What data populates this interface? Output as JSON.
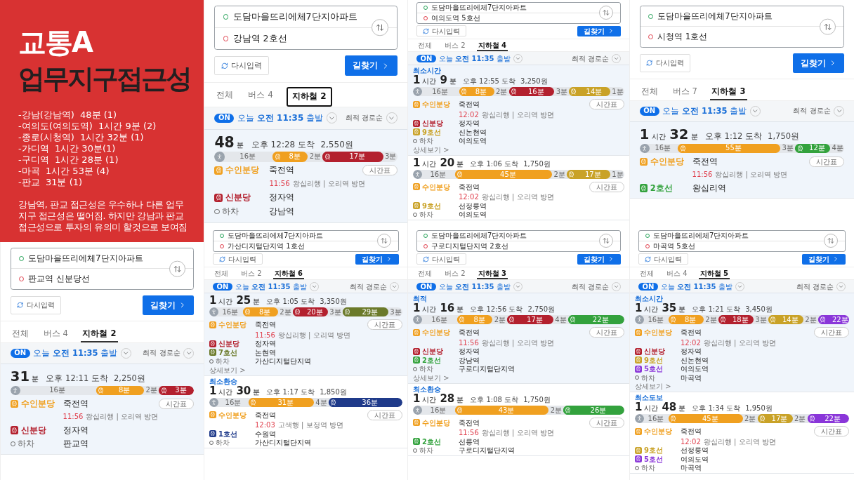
{
  "slide": {
    "title": "교통A",
    "subtitle": "업무지구접근성",
    "summary": [
      "-강남(강남역)  48분 (1)",
      "-여의도(여의도역)  1시간 9분 (2)",
      "-종로(시청역)  1시간 32분 (1)",
      "-가디역  1시간 30분(1)",
      "-구디역  1시간 28분 (1)",
      "-마곡  1시간 53분 (4)",
      "-판교  31분 (1)"
    ],
    "paragraph": "강남역, 판교 접근성은 우수하나 다른 업무 지구 접근성은 떨어짐. 하지만 강남과 판교 접근성으로 투자의 유의미 할것으로 보여짐"
  },
  "panels": [
    {
      "origin": "도담마을뜨리에체7단지아파트",
      "destination": "강남역 2호선",
      "reset": "다시입력",
      "search": "길찾기",
      "tabs": [
        {
          "label": "전체",
          "selected": false,
          "boxed": false
        },
        {
          "label": "버스 4",
          "selected": false,
          "boxed": false
        },
        {
          "label": "지하철 2",
          "selected": true,
          "boxed": true
        }
      ],
      "on_badge": "ON",
      "departure": "오늘 **오전 11:35** 출발",
      "sort": "최적 경로순",
      "routes": [
        {
          "duration": [
            {
              "num": "48",
              "unit": "분"
            }
          ],
          "arrival": "오후 12:28 도착",
          "fare": "2,550원",
          "segments": [
            {
              "kind": "walk",
              "label": "16분"
            },
            {
              "kind": "ride",
              "color": "#f0a020",
              "label": "8분"
            },
            {
              "kind": "gap",
              "label": "2분"
            },
            {
              "kind": "ride",
              "color": "#b3202e",
              "label": "17분"
            },
            {
              "kind": "gap",
              "label": "3분"
            }
          ],
          "steps": [
            {
              "kind": "ride",
              "color": "#f0a020",
              "line": "수인분당",
              "station": "죽전역",
              "timetable": "시간표",
              "detail_time": "11:56",
              "detail_text": "왕십리행 | 오리역 방면"
            },
            {
              "kind": "ride",
              "color": "#b3202e",
              "line": "신분당",
              "station": "정자역"
            },
            {
              "kind": "alight",
              "line": "하차",
              "station": "강남역"
            }
          ]
        }
      ]
    },
    {
      "origin": "도담마을뜨리에체7단지아파트",
      "destination": "여의도역 5호선",
      "reset": "다시입력",
      "search": "길찾기",
      "tabs": [
        {
          "label": "전체",
          "selected": false
        },
        {
          "label": "버스 2",
          "selected": false
        },
        {
          "label": "지하철 4",
          "selected": true
        }
      ],
      "on_badge": "ON",
      "departure": "오늘 **오전 11:35** 출발",
      "sort": "최적 경로순",
      "routes": [
        {
          "tag": "최소시간",
          "duration": [
            {
              "num": "1",
              "unit": "시간"
            },
            {
              "num": "9",
              "unit": "분"
            }
          ],
          "arrival": "오후 12:55 도착",
          "fare": "3,250원",
          "segments": [
            {
              "kind": "walk",
              "label": "16분"
            },
            {
              "kind": "ride",
              "color": "#f0a020",
              "label": "8분"
            },
            {
              "kind": "gap",
              "label": "2분"
            },
            {
              "kind": "ride",
              "color": "#b3202e",
              "label": "16분"
            },
            {
              "kind": "gap",
              "label": "3분"
            },
            {
              "kind": "ride",
              "color": "#c9a227",
              "label": "14분"
            },
            {
              "kind": "gap",
              "label": "1분"
            }
          ],
          "steps": [
            {
              "kind": "ride",
              "color": "#f0a020",
              "line": "수인분당",
              "station": "죽전역",
              "timetable": "시간표",
              "detail_time": "12:02",
              "detail_text": "왕십리행 | 오리역 방면"
            },
            {
              "kind": "ride",
              "color": "#b3202e",
              "line": "신분당",
              "station": "정자역"
            },
            {
              "kind": "ride",
              "color": "#c9a227",
              "line": "9호선",
              "station": "신논현역"
            },
            {
              "kind": "alight",
              "line": "하차",
              "station": "여의도역"
            }
          ],
          "more": "상세보기 >"
        },
        {
          "duration": [
            {
              "num": "1",
              "unit": "시간"
            },
            {
              "num": "20",
              "unit": "분"
            }
          ],
          "arrival": "오후 1:06 도착",
          "fare": "1,750원",
          "segments": [
            {
              "kind": "walk",
              "label": "16분"
            },
            {
              "kind": "ride",
              "color": "#f0a020",
              "label": "45분"
            },
            {
              "kind": "gap",
              "label": "2분"
            },
            {
              "kind": "ride",
              "color": "#c9a227",
              "label": "17분"
            },
            {
              "kind": "gap",
              "label": "1분"
            }
          ],
          "steps": [
            {
              "kind": "ride",
              "color": "#f0a020",
              "line": "수인분당",
              "station": "죽전역",
              "timetable": "시간표",
              "detail_time": "12:02",
              "detail_text": "왕십리행 | 오리역 방면"
            },
            {
              "kind": "ride",
              "color": "#c9a227",
              "line": "9호선",
              "station": "선정릉역"
            },
            {
              "kind": "alight",
              "line": "하차",
              "station": "여의도역"
            }
          ]
        }
      ]
    },
    {
      "origin": "도담마을뜨리에체7단지아파트",
      "destination": "시청역 1호선",
      "reset": "다시입력",
      "search": "길찾기",
      "tabs": [
        {
          "label": "전체",
          "selected": false
        },
        {
          "label": "버스 7",
          "selected": false
        },
        {
          "label": "지하철 3",
          "selected": true
        }
      ],
      "on_badge": "ON",
      "departure": "오늘 **오전 11:35** 출발",
      "sort": "최적 경로순",
      "routes": [
        {
          "duration": [
            {
              "num": "1",
              "unit": "시간"
            },
            {
              "num": "32",
              "unit": "분"
            }
          ],
          "arrival": "오후 1:12 도착",
          "fare": "1,750원",
          "segments": [
            {
              "kind": "walk",
              "label": "16분"
            },
            {
              "kind": "ride",
              "color": "#f0a020",
              "label": "55분"
            },
            {
              "kind": "gap",
              "label": "3분"
            },
            {
              "kind": "ride",
              "color": "#33a23d",
              "label": "12분"
            },
            {
              "kind": "gap",
              "label": "4분"
            }
          ],
          "steps": [
            {
              "kind": "ride",
              "color": "#f0a020",
              "line": "수인분당",
              "station": "죽전역",
              "timetable": "시간표",
              "detail_time": "11:56",
              "detail_text": "왕십리행 | 오리역 방면"
            },
            {
              "kind": "ride",
              "color": "#33a23d",
              "line": "2호선",
              "station": "왕십리역"
            }
          ]
        }
      ]
    },
    {
      "origin": "도담마을뜨리에체7단지아파트",
      "destination": "판교역 신분당선",
      "reset": "다시입력",
      "search": "길찾기",
      "tabs": [
        {
          "label": "전체",
          "selected": false
        },
        {
          "label": "버스 4",
          "selected": false
        },
        {
          "label": "지하철 2",
          "selected": true
        }
      ],
      "on_badge": "ON",
      "departure": "오늘 **오전 11:35** 출발",
      "sort": "최적 경로순",
      "routes": [
        {
          "duration": [
            {
              "num": "31",
              "unit": "분"
            }
          ],
          "arrival": "오후 12:11 도착",
          "fare": "2,250원",
          "segments": [
            {
              "kind": "walk",
              "label": "16분"
            },
            {
              "kind": "ride",
              "color": "#f0a020",
              "label": "8분"
            },
            {
              "kind": "gap",
              "label": "2분"
            },
            {
              "kind": "ride",
              "color": "#b3202e",
              "label": "3분"
            }
          ],
          "steps": [
            {
              "kind": "ride",
              "color": "#f0a020",
              "line": "수인분당",
              "station": "죽전역",
              "timetable": "시간표",
              "detail_time": "11:56",
              "detail_text": "왕십리행 | 오리역 방면"
            },
            {
              "kind": "ride",
              "color": "#b3202e",
              "line": "신분당",
              "station": "정자역"
            },
            {
              "kind": "alight",
              "line": "하차",
              "station": "판교역"
            }
          ]
        }
      ]
    },
    {
      "origin": "도담마을뜨리에체7단지아파트",
      "destination": "가산디지털단지역 1호선",
      "reset": "다시입력",
      "search": "길찾기",
      "tabs": [
        {
          "label": "전체",
          "selected": false
        },
        {
          "label": "버스 2",
          "selected": false
        },
        {
          "label": "지하철 6",
          "selected": true
        }
      ],
      "on_badge": "ON",
      "departure": "오늘 **오전 11:35** 출발",
      "sort": "최적 경로순",
      "routes": [
        {
          "duration": [
            {
              "num": "1",
              "unit": "시간"
            },
            {
              "num": "25",
              "unit": "분"
            }
          ],
          "arrival": "오후 1:05 도착",
          "fare": "3,350원",
          "segments": [
            {
              "kind": "walk",
              "label": "16분"
            },
            {
              "kind": "ride",
              "color": "#f0a020",
              "label": "8분"
            },
            {
              "kind": "gap",
              "label": "2분"
            },
            {
              "kind": "ride",
              "color": "#b3202e",
              "label": "20분"
            },
            {
              "kind": "gap",
              "label": "3분"
            },
            {
              "kind": "ride",
              "color": "#6b7a2a",
              "label": "29분"
            },
            {
              "kind": "gap",
              "label": "3분"
            }
          ],
          "steps": [
            {
              "kind": "ride",
              "color": "#f0a020",
              "line": "수인분당",
              "station": "죽전역",
              "timetable": "시간표",
              "detail_time": "11:56",
              "detail_text": "왕십리행 | 오리역 방면"
            },
            {
              "kind": "ride",
              "color": "#b3202e",
              "line": "신분당",
              "station": "정자역"
            },
            {
              "kind": "ride",
              "color": "#6b7a2a",
              "line": "7호선",
              "station": "논현역"
            },
            {
              "kind": "alight",
              "line": "하차",
              "station": "가산디지털단지역"
            }
          ],
          "more": "상세보기 >"
        },
        {
          "tag": "최소환승",
          "duration": [
            {
              "num": "1",
              "unit": "시간"
            },
            {
              "num": "30",
              "unit": "분"
            }
          ],
          "arrival": "오후 1:17 도착",
          "fare": "1,850원",
          "segments": [
            {
              "kind": "walk",
              "label": "16분"
            },
            {
              "kind": "ride",
              "color": "#f0a020",
              "label": "31분"
            },
            {
              "kind": "gap",
              "label": "4분"
            },
            {
              "kind": "ride",
              "color": "#1f3a8a",
              "label": "36분"
            }
          ],
          "steps": [
            {
              "kind": "ride",
              "color": "#f0a020",
              "line": "수인분당",
              "station": "죽전역",
              "timetable": "시간표",
              "detail_time": "12:03",
              "detail_text": "고색행 | 보정역 방면"
            },
            {
              "kind": "ride",
              "color": "#1f3a8a",
              "line": "1호선",
              "station": "수원역"
            },
            {
              "kind": "alight",
              "line": "하차",
              "station": "가산디지털단지역"
            }
          ]
        }
      ]
    },
    {
      "origin": "도담마을뜨리에체7단지아파트",
      "destination": "구로디지털단지역 2호선",
      "reset": "다시입력",
      "search": "길찾기",
      "tabs": [
        {
          "label": "전체",
          "selected": false
        },
        {
          "label": "버스 2",
          "selected": false
        },
        {
          "label": "지하철 3",
          "selected": true
        }
      ],
      "on_badge": "ON",
      "departure": "오늘 **오전 11:35** 출발",
      "sort": "최적 경로순",
      "routes": [
        {
          "tag": "최적",
          "duration": [
            {
              "num": "1",
              "unit": "시간"
            },
            {
              "num": "16",
              "unit": "분"
            }
          ],
          "arrival": "오후 12:56 도착",
          "fare": "2,750원",
          "segments": [
            {
              "kind": "walk",
              "label": "16분"
            },
            {
              "kind": "ride",
              "color": "#f0a020",
              "label": "8분"
            },
            {
              "kind": "gap",
              "label": "2분"
            },
            {
              "kind": "ride",
              "color": "#b3202e",
              "label": "17분"
            },
            {
              "kind": "gap",
              "label": "4분"
            },
            {
              "kind": "ride",
              "color": "#33a23d",
              "label": "22분"
            }
          ],
          "steps": [
            {
              "kind": "ride",
              "color": "#f0a020",
              "line": "수인분당",
              "station": "죽전역",
              "timetable": "시간표",
              "detail_time": "11:56",
              "detail_text": "왕십리행 | 오리역 방면"
            },
            {
              "kind": "ride",
              "color": "#b3202e",
              "line": "신분당",
              "station": "정자역"
            },
            {
              "kind": "ride",
              "color": "#33a23d",
              "line": "2호선",
              "station": "강남역"
            },
            {
              "kind": "alight",
              "line": "하차",
              "station": "구로디지털단지역"
            }
          ],
          "more": "상세보기 >"
        },
        {
          "tag": "최소환승",
          "duration": [
            {
              "num": "1",
              "unit": "시간"
            },
            {
              "num": "28",
              "unit": "분"
            }
          ],
          "arrival": "오후 1:08 도착",
          "fare": "1,750원",
          "segments": [
            {
              "kind": "walk",
              "label": "16분"
            },
            {
              "kind": "ride",
              "color": "#f0a020",
              "label": "43분"
            },
            {
              "kind": "gap",
              "label": "2분"
            },
            {
              "kind": "ride",
              "color": "#33a23d",
              "label": "26분"
            }
          ],
          "steps": [
            {
              "kind": "ride",
              "color": "#f0a020",
              "line": "수인분당",
              "station": "죽전역",
              "timetable": "시간표",
              "detail_time": "11:56",
              "detail_text": "왕십리행 | 오리역 방면"
            },
            {
              "kind": "ride",
              "color": "#33a23d",
              "line": "2호선",
              "station": "선릉역"
            },
            {
              "kind": "alight",
              "line": "하차",
              "station": "구로디지털단지역"
            }
          ]
        }
      ]
    },
    {
      "origin": "도담마을뜨리에체7단지아파트",
      "destination": "마곡역 5호선",
      "reset": "다시입력",
      "search": "길찾기",
      "tabs": [
        {
          "label": "전체",
          "selected": false
        },
        {
          "label": "버스 4",
          "selected": false
        },
        {
          "label": "지하철 5",
          "selected": true
        }
      ],
      "on_badge": "ON",
      "departure": "오늘 **오전 11:35** 출발",
      "sort": "최적 경로순",
      "routes": [
        {
          "tag": "최소시간",
          "duration": [
            {
              "num": "1",
              "unit": "시간"
            },
            {
              "num": "35",
              "unit": "분"
            }
          ],
          "arrival": "오후 1:21 도착",
          "fare": "3,450원",
          "segments": [
            {
              "kind": "walk",
              "label": "16분"
            },
            {
              "kind": "ride",
              "color": "#f0a020",
              "label": "8분"
            },
            {
              "kind": "gap",
              "label": "2분"
            },
            {
              "kind": "ride",
              "color": "#b3202e",
              "label": "18분"
            },
            {
              "kind": "gap",
              "label": "3분"
            },
            {
              "kind": "ride",
              "color": "#c9a227",
              "label": "14분"
            },
            {
              "kind": "gap",
              "label": "2분"
            },
            {
              "kind": "ride",
              "color": "#8a36d9",
              "label": "22분"
            }
          ],
          "steps": [
            {
              "kind": "ride",
              "color": "#f0a020",
              "line": "수인분당",
              "station": "죽전역",
              "timetable": "시간표",
              "detail_time": "12:02",
              "detail_text": "왕십리행 | 오리역 방면"
            },
            {
              "kind": "ride",
              "color": "#b3202e",
              "line": "신분당",
              "station": "정자역"
            },
            {
              "kind": "ride",
              "color": "#c9a227",
              "line": "9호선",
              "station": "신논현역"
            },
            {
              "kind": "ride",
              "color": "#8a36d9",
              "line": "5호선",
              "station": "여의도역"
            },
            {
              "kind": "alight",
              "line": "하차",
              "station": "마곡역"
            }
          ],
          "more": "상세보기 >"
        },
        {
          "tag": "최소도보",
          "duration": [
            {
              "num": "1",
              "unit": "시간"
            },
            {
              "num": "48",
              "unit": "분"
            }
          ],
          "arrival": "오후 1:34 도착",
          "fare": "1,950원",
          "segments": [
            {
              "kind": "walk",
              "label": "16분"
            },
            {
              "kind": "ride",
              "color": "#f0a020",
              "label": "45분"
            },
            {
              "kind": "gap",
              "label": "2분"
            },
            {
              "kind": "ride",
              "color": "#c9a227",
              "label": "17분"
            },
            {
              "kind": "gap",
              "label": "2분"
            },
            {
              "kind": "ride",
              "color": "#8a36d9",
              "label": "22분"
            }
          ],
          "steps": [
            {
              "kind": "ride",
              "color": "#f0a020",
              "line": "수인분당",
              "station": "죽전역",
              "timetable": "시간표",
              "detail_time": "12:02",
              "detail_text": "왕십리행 | 오리역 방면"
            },
            {
              "kind": "ride",
              "color": "#c9a227",
              "line": "9호선",
              "station": "선정릉역"
            },
            {
              "kind": "ride",
              "color": "#8a36d9",
              "line": "5호선",
              "station": "여의도역"
            },
            {
              "kind": "alight",
              "line": "하차",
              "station": "마곡역"
            }
          ]
        }
      ]
    }
  ]
}
